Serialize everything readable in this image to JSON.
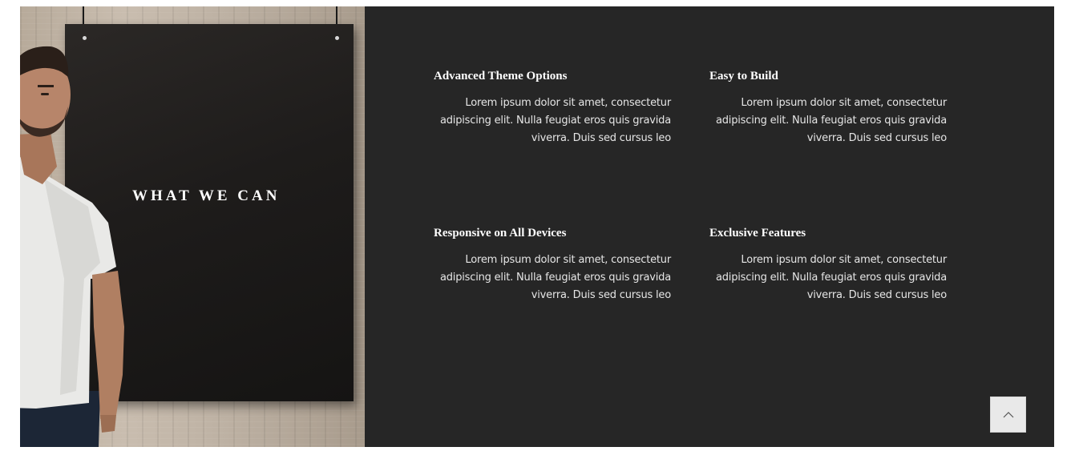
{
  "panel": {
    "heading": "WHAT WE CAN"
  },
  "features": [
    {
      "title": "Advanced Theme Options",
      "text": "Lorem ipsum dolor sit amet, consectetur adipiscing elit. Nulla feugiat eros quis gravida viverra. Duis sed cursus leo"
    },
    {
      "title": "Easy to Build",
      "text": "Lorem ipsum dolor sit amet, consectetur adipiscing elit. Nulla feugiat eros quis gravida viverra. Duis sed cursus leo"
    },
    {
      "title": "Responsive on All Devices",
      "text": "Lorem ipsum dolor sit amet, consectetur adipiscing elit. Nulla feugiat eros quis gravida viverra. Duis sed cursus leo"
    },
    {
      "title": "Exclusive Features",
      "text": "Lorem ipsum dolor sit amet, consectetur adipiscing elit. Nulla feugiat eros quis gravida viverra. Duis sed cursus leo"
    }
  ],
  "back_to_top": {
    "icon": "chevron-up-icon"
  },
  "colors": {
    "dark_panel": "#262626",
    "heading_text": "#ffffff",
    "body_text": "#e6e6e6",
    "back_to_top_bg": "#e9e9e9"
  }
}
